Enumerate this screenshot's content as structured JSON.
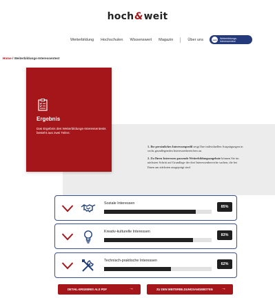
{
  "brand": {
    "part1": "hoch",
    "amp": "&",
    "part2": "weit",
    "accent_color": "#a4161a"
  },
  "nav": {
    "items": [
      "Weiterbildung",
      "Hochschulen",
      "Wissenswert",
      "Magazin",
      "Über uns"
    ],
    "cta": {
      "badge": "weit",
      "line1": "Weiterbildungs-",
      "line2": "Interessentest",
      "color": "#243a7a"
    }
  },
  "breadcrumb": {
    "home": "Home",
    "separator": " / ",
    "current": "Weiterbildungs-Interessentest"
  },
  "result": {
    "title": "Ergebnis",
    "description": "Das Ergebnis des Weiterbildungs-Interessentests besteht aus zwei Teilen:",
    "icon": "clipboard-checklist-icon"
  },
  "info": {
    "p1_bold": "1. Ihr persönliches Interessenprofil",
    "p1_rest": " zeigt Ihre individuellen Ausprägungen in sechs grundlegenden Interessenbereichen an.",
    "p2_bold": "2. Zu Ihren Interessen passende Weiterbildungsangebote",
    "p2_rest": " können Sie im nächsten Schritt auf Grundlage der drei Interessenbereiche suchen, die bei Ihnen am stärksten ausgeprägt sind."
  },
  "interests": [
    {
      "label": "Soziale Interessen",
      "percent": 85,
      "display": "85%",
      "icon": "handshake-icon"
    },
    {
      "label": "Kreativ-kulturelle Interessen",
      "percent": 83,
      "display": "83%",
      "icon": "lightbulb-icon"
    },
    {
      "label": "Technisch-praktische Interessen",
      "percent": 62,
      "display": "62%",
      "icon": "tools-icon"
    }
  ],
  "buttons": {
    "pdf": "DETAIL-ERGEBNIS ALS PDF",
    "offers": "ZU DEN WEITERBILDUNGSANGEBOTEN",
    "arrow": "→"
  }
}
